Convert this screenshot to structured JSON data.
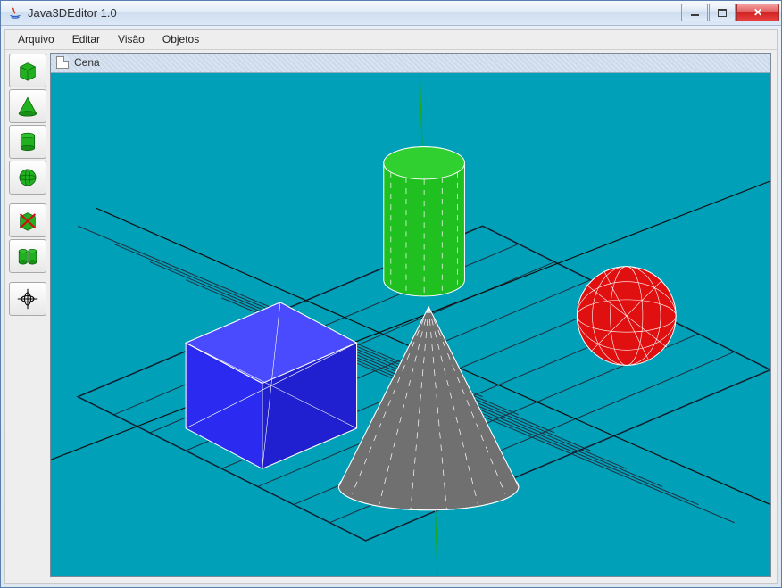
{
  "window": {
    "title": "Java3DEditor 1.0",
    "buttons": {
      "minimize": "–",
      "maximize": "□",
      "close": "✕"
    }
  },
  "menu": {
    "items": [
      "Arquivo",
      "Editar",
      "Visão",
      "Objetos"
    ]
  },
  "toolbar": {
    "groups": [
      [
        {
          "name": "cube-tool",
          "icon": "cube"
        },
        {
          "name": "cone-tool",
          "icon": "cone"
        },
        {
          "name": "cylinder-tool",
          "icon": "cylinder"
        },
        {
          "name": "sphere-tool",
          "icon": "sphere"
        }
      ],
      [
        {
          "name": "delete-tool",
          "icon": "delete-cube"
        },
        {
          "name": "duplicate-tool",
          "icon": "two-cylinders"
        }
      ],
      [
        {
          "name": "origin-tool",
          "icon": "crosshair"
        }
      ]
    ]
  },
  "scene": {
    "panel_title": "Cena",
    "background": "#00a0b8",
    "grid_color": "#203040",
    "axes": {
      "x": "#202020",
      "y": "#1aa81a",
      "z": "#202020"
    },
    "objects": [
      {
        "type": "cube",
        "color": "#2a2af0",
        "wire": "#ffffff"
      },
      {
        "type": "cylinder",
        "color": "#20c020",
        "wire": "#ffffff"
      },
      {
        "type": "cone",
        "color": "#707070",
        "wire": "#ffffff"
      },
      {
        "type": "sphere",
        "color": "#e01010",
        "wire": "#ffffff"
      }
    ]
  }
}
